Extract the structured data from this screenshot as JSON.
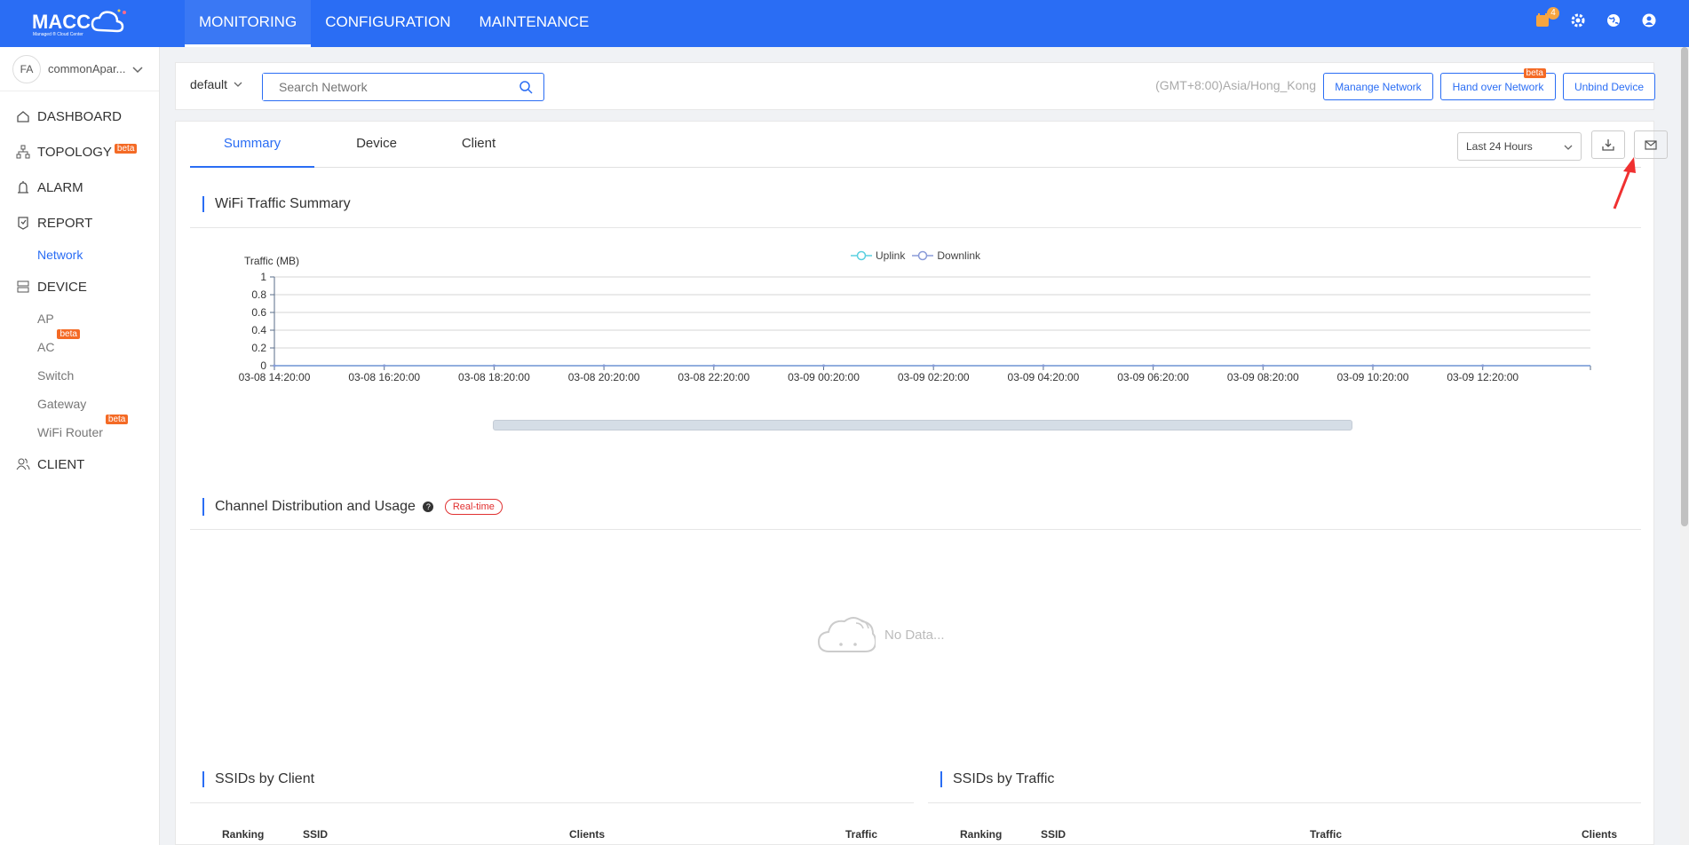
{
  "header": {
    "logo_text": "MACC",
    "logo_subtext": "Managed ® Cloud Center",
    "nav": [
      "MONITORING",
      "CONFIGURATION",
      "MAINTENANCE"
    ],
    "notification_count": "4"
  },
  "sidebar": {
    "tenant_initials": "FA",
    "tenant_name": "commonApar...",
    "items": [
      {
        "label": "DASHBOARD",
        "icon": "home-icon"
      },
      {
        "label": "TOPOLOGY",
        "icon": "topology-icon",
        "beta": "beta"
      },
      {
        "label": "ALARM",
        "icon": "alarm-icon"
      },
      {
        "label": "REPORT",
        "icon": "report-icon"
      },
      {
        "label": "Network",
        "sub": true
      },
      {
        "label": "DEVICE",
        "icon": "device-icon"
      },
      {
        "label": "AP",
        "sub": true
      },
      {
        "label": "AC",
        "sub": true,
        "beta": "beta"
      },
      {
        "label": "Switch",
        "sub": true
      },
      {
        "label": "Gateway",
        "sub": true
      },
      {
        "label": "WiFi Router",
        "sub": true,
        "beta": "beta"
      },
      {
        "label": "CLIENT",
        "icon": "client-icon"
      }
    ]
  },
  "filter": {
    "network": "default",
    "search_placeholder": "Search Network",
    "timezone": "(GMT+8:00)Asia/Hong_Kong",
    "btn_manage": "Manange Network",
    "btn_handover": "Hand over Network",
    "btn_handover_beta": "beta",
    "btn_unbind": "Unbind Device"
  },
  "tabs": [
    "Summary",
    "Device",
    "Client"
  ],
  "time_range": "Last 24 Hours",
  "sections": {
    "wifi_traffic": "WiFi Traffic Summary",
    "channel": "Channel Distribution and Usage",
    "realtime": "Real-time",
    "no_data": "No Data...",
    "ssids_client": "SSIDs by Client",
    "ssids_traffic": "SSIDs by Traffic"
  },
  "chart_data": {
    "type": "line",
    "title": "",
    "ylabel": "Traffic (MB)",
    "ylim": [
      0,
      1
    ],
    "yticks": [
      "1",
      "0.8",
      "0.6",
      "0.4",
      "0.2",
      "0"
    ],
    "categories": [
      "03-08 14:20:00",
      "03-08 16:20:00",
      "03-08 18:20:00",
      "03-08 20:20:00",
      "03-08 22:20:00",
      "03-09 00:20:00",
      "03-09 02:20:00",
      "03-09 04:20:00",
      "03-09 06:20:00",
      "03-09 08:20:00",
      "03-09 10:20:00",
      "03-09 12:20:00"
    ],
    "series": [
      {
        "name": "Uplink",
        "color": "#5ad0e0",
        "values": [
          0,
          0,
          0,
          0,
          0,
          0,
          0,
          0,
          0,
          0,
          0,
          0
        ]
      },
      {
        "name": "Downlink",
        "color": "#8a9bd8",
        "values": [
          0,
          0,
          0,
          0,
          0,
          0,
          0,
          0,
          0,
          0,
          0,
          0
        ]
      }
    ],
    "legend": "top-center",
    "grid": true
  },
  "table_client_headers": [
    "Ranking",
    "SSID",
    "Clients",
    "Traffic"
  ],
  "table_traffic_headers": [
    "Ranking",
    "SSID",
    "Traffic",
    "Clients"
  ]
}
